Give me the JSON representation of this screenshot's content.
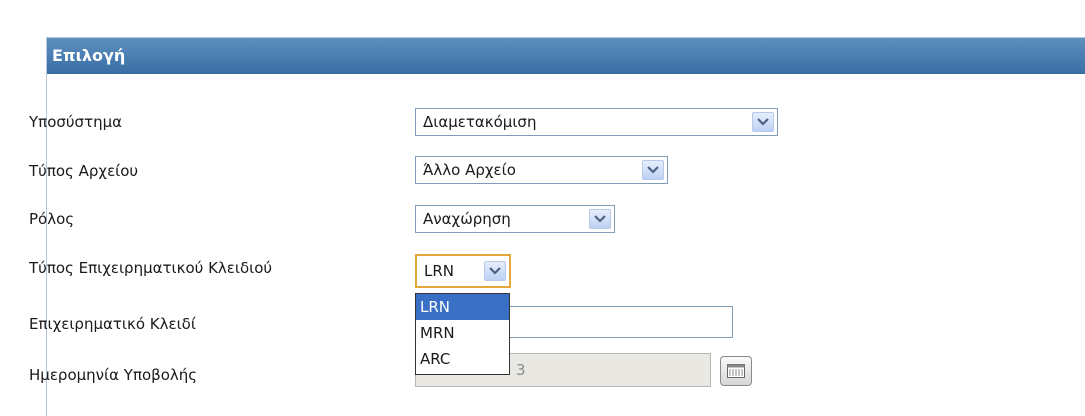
{
  "panel": {
    "title": "Επιλογή"
  },
  "form": {
    "subsystem": {
      "label": "Υποσύστημα",
      "value": "Διαμετακόμιση"
    },
    "file_type": {
      "label": "Τύπος Αρχείου",
      "value": "Άλλο Αρχείο"
    },
    "role": {
      "label": "Ρόλος",
      "value": "Αναχώρηση"
    },
    "business_key_type": {
      "label": "Τύπος Επιχειρηματικού Κλειδιού",
      "value": "LRN",
      "options": [
        "LRN",
        "MRN",
        "ARC"
      ],
      "selected_index": 0
    },
    "business_key": {
      "label": "Επιχειρηματικό Κλειδί",
      "value": ""
    },
    "submission_date": {
      "label": "Ημερομηνία Υποβολής",
      "value": "3",
      "icon": "calendar-icon"
    }
  },
  "colors": {
    "header": "#3a6ea5",
    "selected_option": "#3a6fc6",
    "focus_border": "#e5a83a"
  }
}
